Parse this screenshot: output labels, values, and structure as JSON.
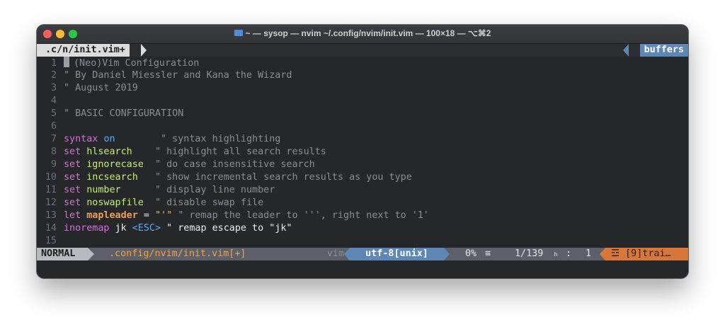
{
  "window": {
    "title": "~ — sysop — nvim ~/.config/nvim/init.vim — 100×18 — ⌥⌘2"
  },
  "tabline": {
    "active_tab": ".c/n/init.vim+",
    "buffers_label": "buffers"
  },
  "lines": [
    {
      "n": "1",
      "text": "(Neo)Vim Configuration"
    },
    {
      "n": "2",
      "text": "\" By Daniel Miessler and Kana the Wizard"
    },
    {
      "n": "3",
      "text": "\" August 2019"
    },
    {
      "n": "4",
      "text": ""
    },
    {
      "n": "5",
      "text": "\" BASIC CONFIGURATION"
    },
    {
      "n": "6",
      "text": ""
    },
    {
      "n": "7",
      "kw": "syntax",
      "arg": "on",
      "pad": "        ",
      "cmt": "\" syntax highlighting"
    },
    {
      "n": "8",
      "kw": "set",
      "arg": "hlsearch",
      "pad": "    ",
      "cmt": "\" highlight all search results"
    },
    {
      "n": "9",
      "kw": "set",
      "arg": "ignorecase",
      "pad": "  ",
      "cmt": "\" do case insensitive search"
    },
    {
      "n": "10",
      "kw": "set",
      "arg": "incsearch",
      "pad": "   ",
      "cmt": "\" show incremental search results as you type"
    },
    {
      "n": "11",
      "kw": "set",
      "arg": "number",
      "pad": "      ",
      "cmt": "\" display line number"
    },
    {
      "n": "12",
      "kw": "set",
      "arg": "noswapfile",
      "pad": "  ",
      "cmt": "\" disable swap file"
    },
    {
      "n": "13",
      "kw": "let",
      "var": "mapleader",
      "eq": " = ",
      "str": "\"'\"",
      "cmt": " \" remap the leader to ''', right next to '1'"
    },
    {
      "n": "14",
      "kw": "inoremap",
      "lhs": " jk ",
      "key": "<ESC>",
      "rest": " \" remap escape to \"jk\""
    },
    {
      "n": "15",
      "text": ""
    }
  ],
  "statusline": {
    "mode": "NORMAL",
    "file": ".config/nvim/init.vim[+]",
    "filetype": "vim",
    "encoding": "utf-8[unix]",
    "percent": "0%",
    "percent_icon": "≡",
    "line_pos": "1/139",
    "line_icon": "ₕ",
    "col_sep": ":",
    "col": "1",
    "warning_icon": "☲",
    "warning": "[9]trai…"
  },
  "colors": {
    "keyword": "#d670d6",
    "option": "#c6ee6e",
    "boolean": "#5fa8e8",
    "comment": "#8a8d94",
    "variable": "#f0a04b",
    "encoding_bg": "#5d88b6",
    "warning_bg": "#d9773a"
  }
}
